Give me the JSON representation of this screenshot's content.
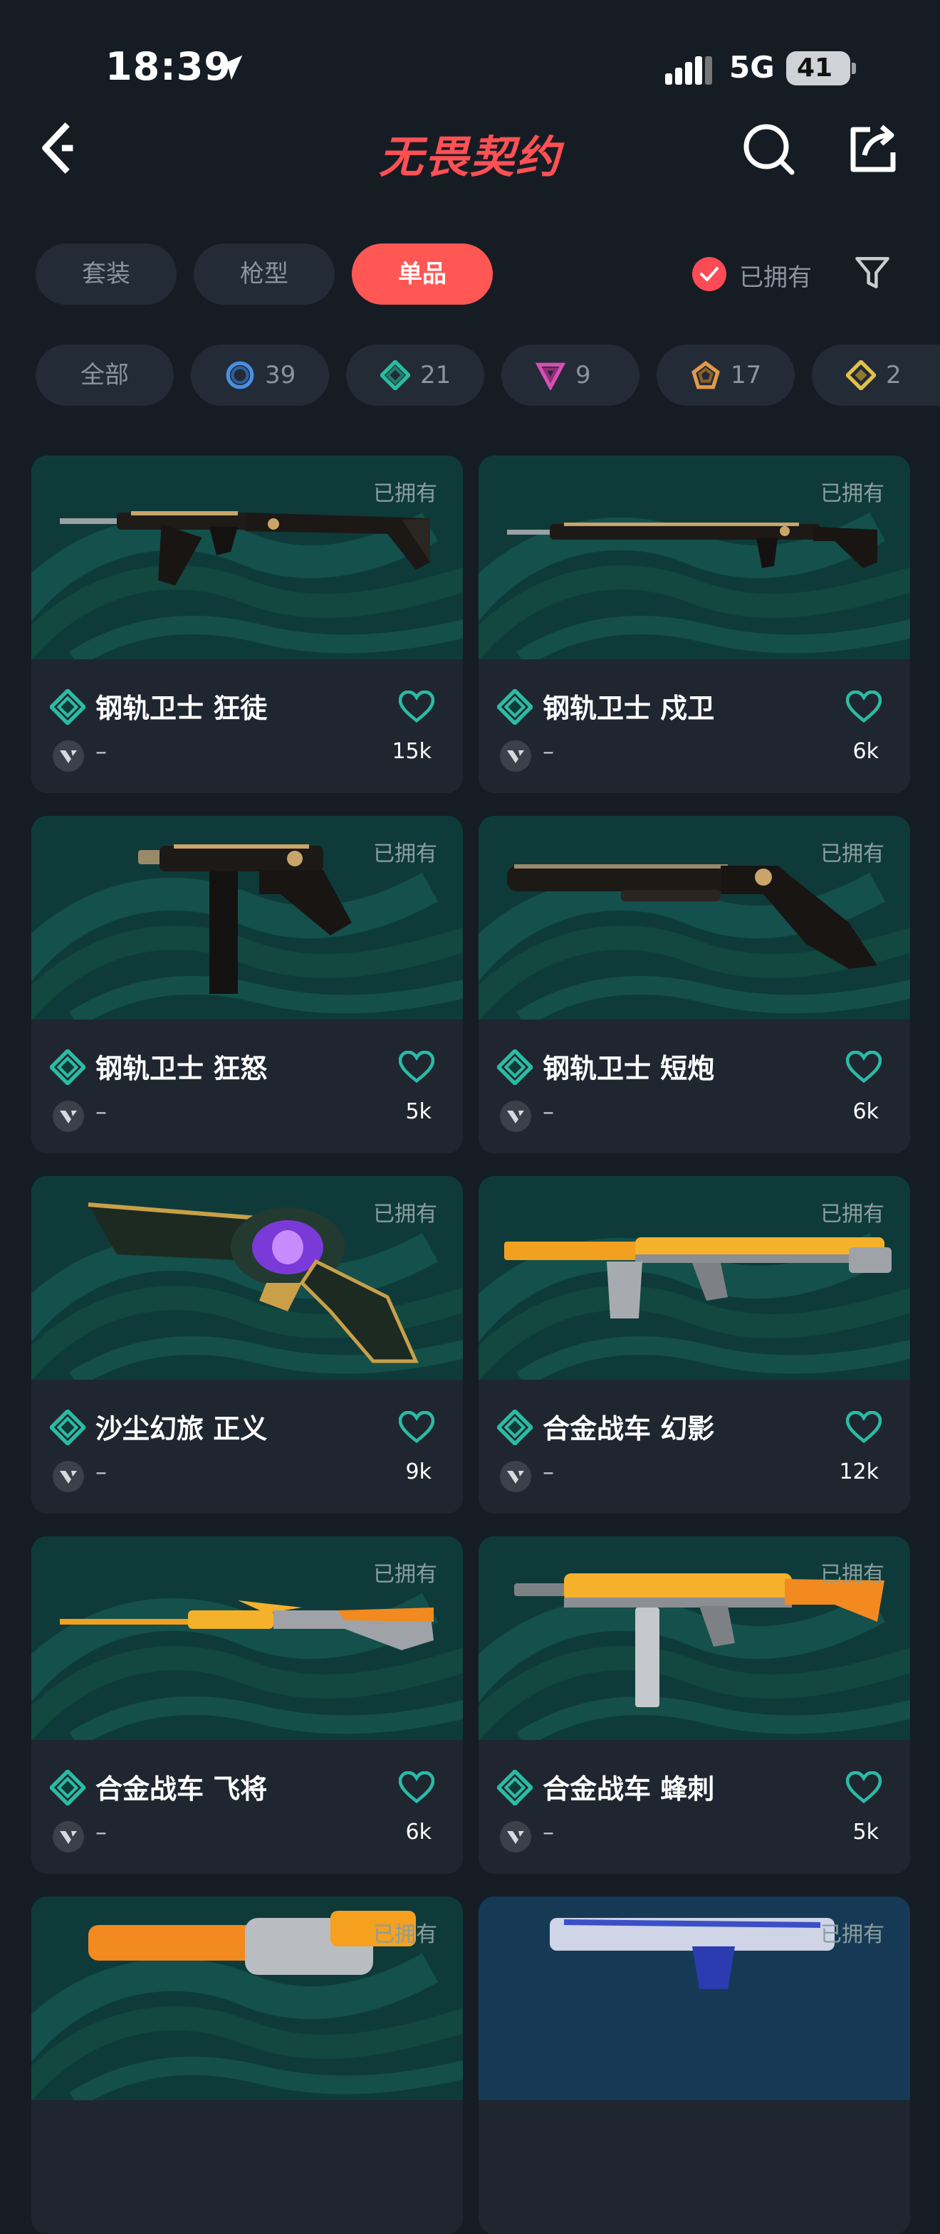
{
  "status": {
    "time": "18:39",
    "network": "5G",
    "battery": "41"
  },
  "nav": {
    "title": "无畏契约"
  },
  "tabs": [
    {
      "label": "套装",
      "active": false
    },
    {
      "label": "枪型",
      "active": false
    },
    {
      "label": "单品",
      "active": true
    }
  ],
  "owned_filter": {
    "label": "已拥有",
    "checked": true
  },
  "chips": [
    {
      "label": "全部"
    },
    {
      "count": "39",
      "color": "#4a8fe0"
    },
    {
      "count": "21",
      "color": "#2bbba4"
    },
    {
      "count": "9",
      "color": "#d64fb4"
    },
    {
      "count": "17",
      "color": "#e09a4a"
    },
    {
      "count": "2",
      "color": "#e0c24a"
    }
  ],
  "items": [
    {
      "name": "钢轨卫士 狂徒",
      "sub": "–",
      "likes": "15k",
      "owned": "已拥有",
      "weapon": "rifle-dark"
    },
    {
      "name": "钢轨卫士 戍卫",
      "sub": "–",
      "likes": "6k",
      "owned": "已拥有",
      "weapon": "dmr-dark"
    },
    {
      "name": "钢轨卫士 狂怒",
      "sub": "–",
      "likes": "5k",
      "owned": "已拥有",
      "weapon": "pistol-dark"
    },
    {
      "name": "钢轨卫士 短炮",
      "sub": "–",
      "likes": "6k",
      "owned": "已拥有",
      "weapon": "shorty-dark"
    },
    {
      "name": "沙尘幻旅 正义",
      "sub": "–",
      "likes": "9k",
      "owned": "已拥有",
      "weapon": "sheriff-gold"
    },
    {
      "name": "合金战车 幻影",
      "sub": "–",
      "likes": "12k",
      "owned": "已拥有",
      "weapon": "rifle-orange"
    },
    {
      "name": "合金战车 飞将",
      "sub": "–",
      "likes": "6k",
      "owned": "已拥有",
      "weapon": "sniper-orange"
    },
    {
      "name": "合金战车 蜂刺",
      "sub": "–",
      "likes": "5k",
      "owned": "已拥有",
      "weapon": "smg-orange"
    },
    {
      "name": "",
      "sub": "",
      "likes": "",
      "owned": "已拥有",
      "weapon": "revolver-orange"
    },
    {
      "name": "",
      "sub": "",
      "likes": "",
      "owned": "已拥有",
      "weapon": "pistol-blue"
    }
  ]
}
